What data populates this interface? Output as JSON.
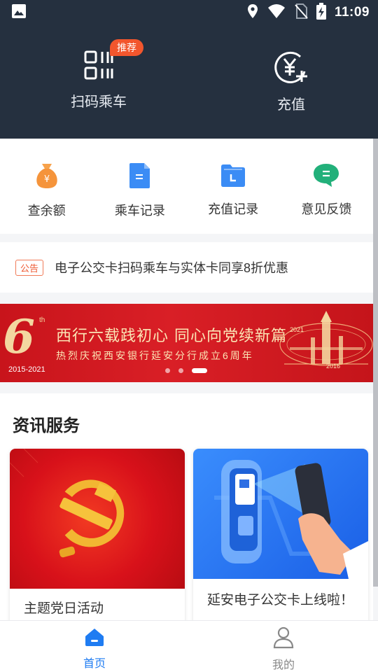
{
  "status_bar": {
    "time": "11:09",
    "icons": [
      "image-icon",
      "location-icon",
      "wifi-icon",
      "no-sim-icon",
      "battery-charging-icon"
    ]
  },
  "header": {
    "scan": {
      "label": "扫码乘车",
      "badge": "推荐",
      "icon": "qr-code-icon"
    },
    "recharge": {
      "label": "充值",
      "icon": "yuan-plus-icon"
    }
  },
  "quick_menu": [
    {
      "label": "查余额",
      "icon": "money-bag-icon",
      "color": "#f5943b"
    },
    {
      "label": "乘车记录",
      "icon": "document-icon",
      "color": "#3b8cf5"
    },
    {
      "label": "充值记录",
      "icon": "folder-icon",
      "color": "#3b8cf5"
    },
    {
      "label": "意见反馈",
      "icon": "chat-icon",
      "color": "#22b07a"
    }
  ],
  "notice": {
    "tag": "公告",
    "text": "电子公交卡扫码乘车与实体卡同享8折优惠"
  },
  "banner": {
    "number": "6",
    "suffix": "th",
    "years": "2015-2021",
    "line1": "西行六载践初心 同心向党续新篇",
    "line2": "热烈庆祝西安银行延安分行成立6周年",
    "year_a": "2021",
    "year_b": "2016",
    "slide_count": 3,
    "active_slide": 3
  },
  "news": {
    "title": "资讯服务",
    "cards": [
      {
        "caption": "主题党日活动",
        "image": "party-emblem-image"
      },
      {
        "caption": "延安电子公交卡上线啦！",
        "image": "phone-scan-image"
      }
    ]
  },
  "bottom_nav": [
    {
      "label": "首页",
      "icon": "home-icon",
      "active": true
    },
    {
      "label": "我的",
      "icon": "user-icon",
      "active": false
    }
  ],
  "colors": {
    "header_bg": "#25303f",
    "accent": "#1f7cf2",
    "badge": "#f2562d",
    "banner_red": "#d91f26"
  }
}
